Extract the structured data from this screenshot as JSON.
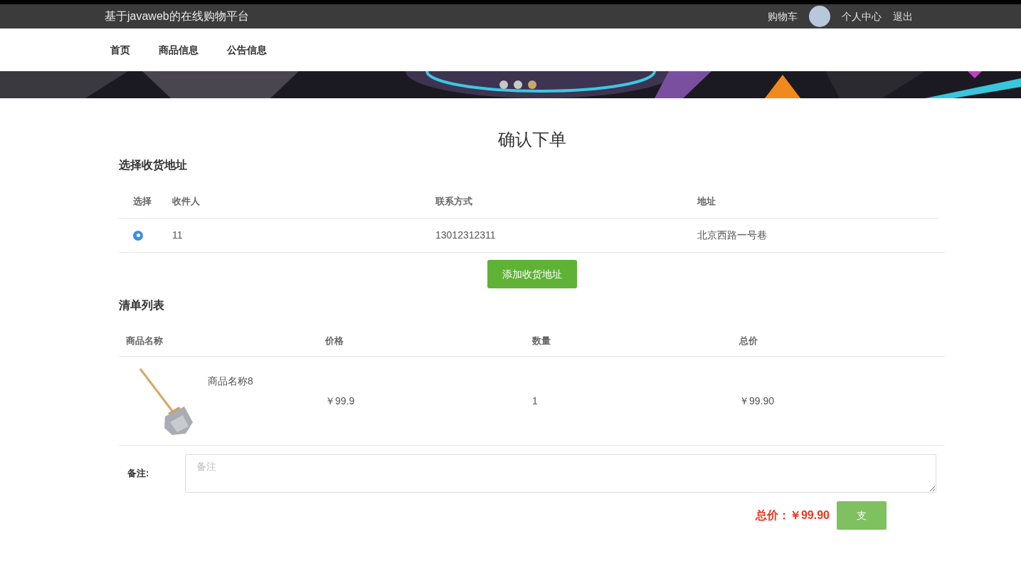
{
  "header": {
    "site_title": "基于javaweb的在线购物平台",
    "links": [
      {
        "label": "购物车",
        "kind": "link"
      },
      {
        "kind": "avatar"
      },
      {
        "label": "个人中心",
        "kind": "link"
      },
      {
        "label": "退出",
        "kind": "link"
      }
    ]
  },
  "nav": {
    "items": [
      "首页",
      "商品信息",
      "公告信息"
    ]
  },
  "banner": {
    "dots": [
      {
        "selected": false
      },
      {
        "selected": false
      },
      {
        "selected": true
      }
    ]
  },
  "page_title": "确认下单",
  "address_section": {
    "heading": "选择收货地址",
    "columns": [
      "选择",
      "收件人",
      "联系方式",
      "地址"
    ],
    "rows": [
      {
        "selected": true,
        "recipient": "11",
        "phone": "13012312311",
        "address": "北京西路一号巷"
      }
    ],
    "add_button": "添加收货地址"
  },
  "order_section": {
    "heading": "清单列表",
    "columns": [
      "商品名称",
      "价格",
      "数量",
      "总价"
    ],
    "rows": [
      {
        "name": "商品名称8",
        "price": "￥99.9",
        "quantity": "1",
        "total": "￥99.90"
      }
    ]
  },
  "remark": {
    "label": "备注:",
    "placeholder": "备注"
  },
  "total": {
    "label": "总价：￥99.90"
  },
  "pay_button": "支"
}
